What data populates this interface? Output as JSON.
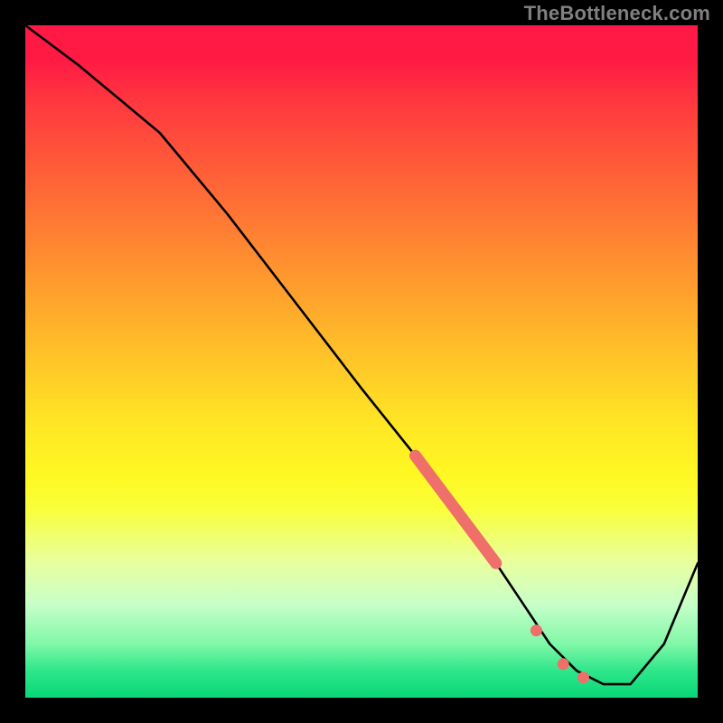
{
  "watermark": "TheBottleneck.com",
  "chart_data": {
    "type": "line",
    "title": "",
    "xlabel": "",
    "ylabel": "",
    "xlim": [
      0,
      100
    ],
    "ylim": [
      0,
      100
    ],
    "series": [
      {
        "name": "curve",
        "x": [
          0,
          8,
          14,
          20,
          30,
          40,
          50,
          58,
          64,
          70,
          74,
          78,
          82,
          86,
          90,
          95,
          100
        ],
        "y": [
          100,
          94,
          89,
          84,
          72,
          59,
          46,
          36,
          28,
          20,
          14,
          8,
          4,
          2,
          2,
          8,
          20
        ]
      }
    ],
    "highlight_segment": {
      "comment": "thick coral dashed stroke along the curve",
      "x": [
        58,
        70
      ],
      "y": [
        36,
        20
      ]
    },
    "highlight_dots": [
      {
        "x": 76,
        "y": 10
      },
      {
        "x": 80,
        "y": 5
      },
      {
        "x": 83,
        "y": 3
      }
    ],
    "colors": {
      "curve": "#000000",
      "highlight": "#ef6f6a"
    }
  }
}
